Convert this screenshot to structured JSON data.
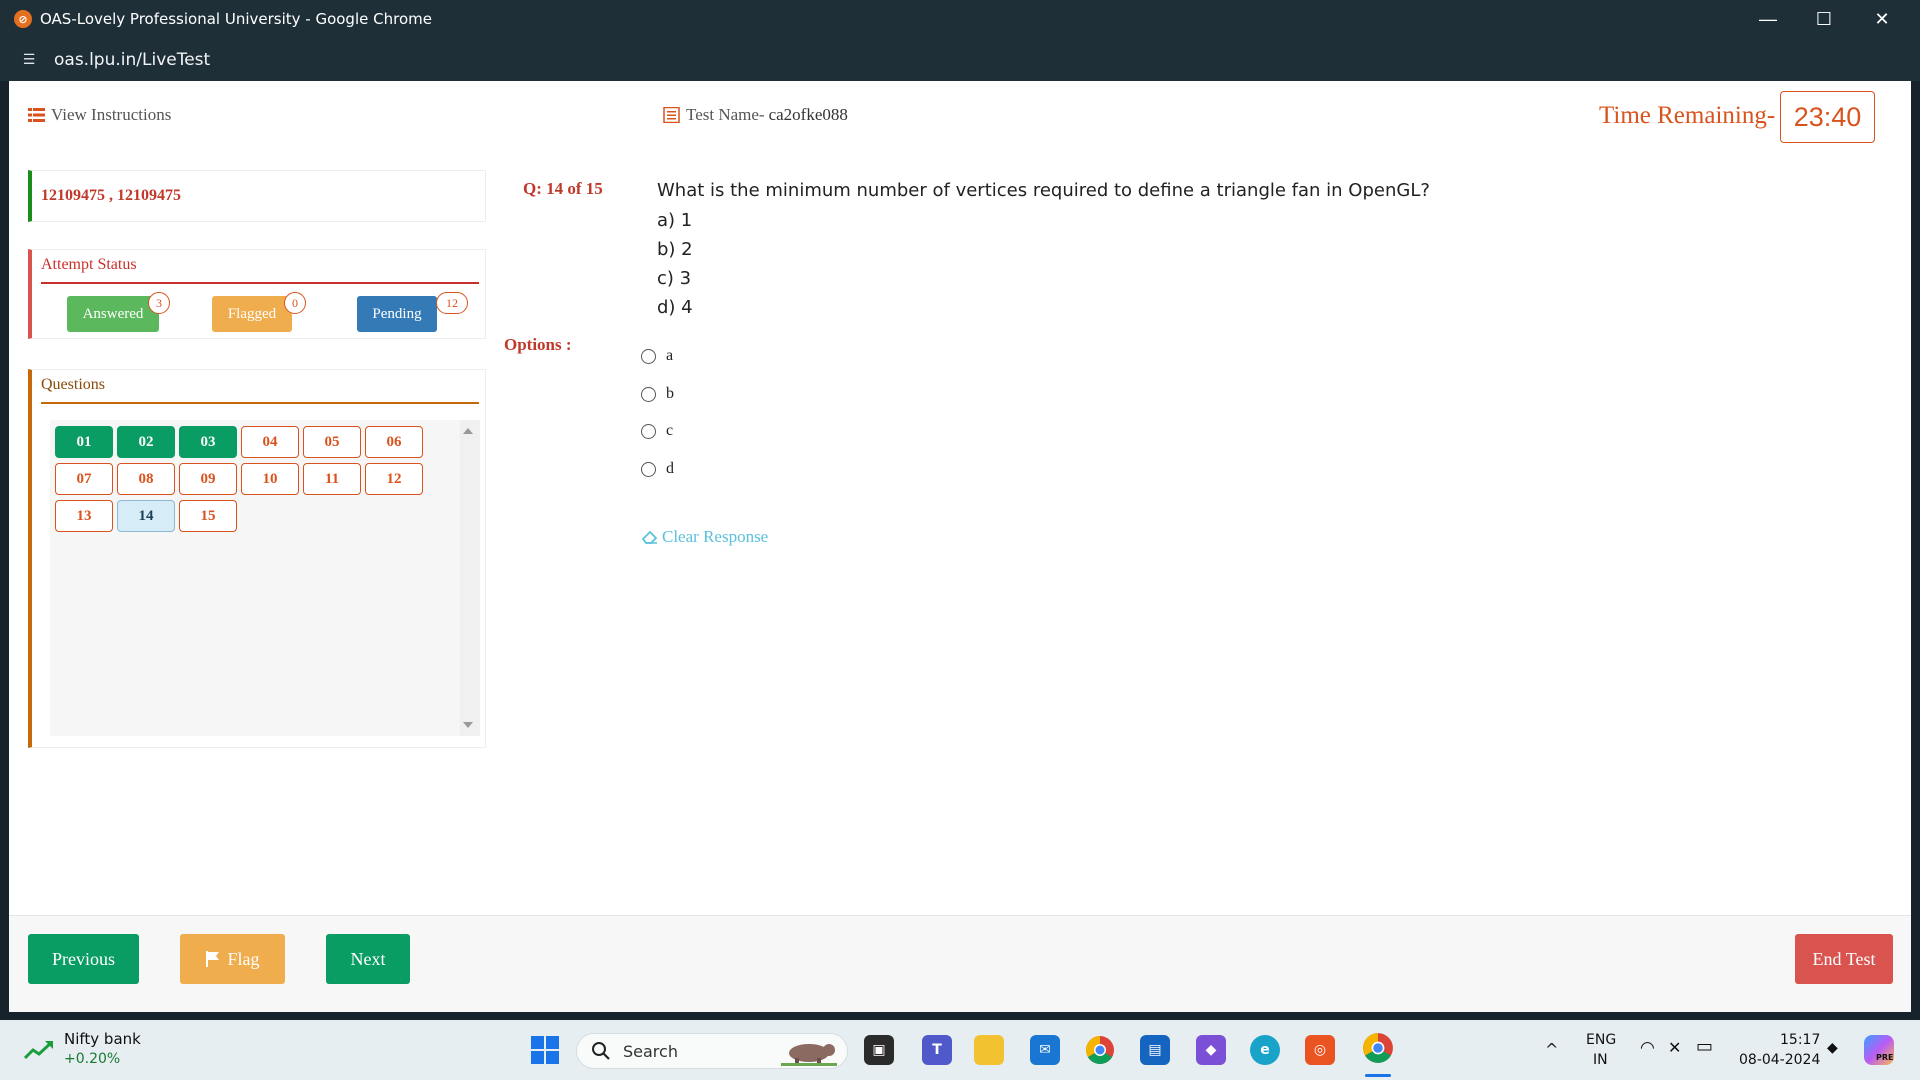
{
  "browser": {
    "window_title": "OAS-Lovely Professional University - Google Chrome",
    "favicon_glyph": "⊘",
    "url": "oas.lpu.in/LiveTest",
    "minimize_glyph": "—",
    "maximize_glyph": "☐",
    "close_glyph": "✕",
    "site_info_glyph": "☰"
  },
  "header": {
    "view_instructions": "View Instructions",
    "test_name_label": "Test Name-",
    "test_name_value": "ca2ofke088",
    "time_label": "Time Remaining-",
    "time_value": "23:40"
  },
  "user": {
    "ids": "12109475 , 12109475"
  },
  "attempt_status": {
    "title": "Attempt Status",
    "answered_label": "Answered",
    "answered_count": "3",
    "flagged_label": "Flagged",
    "flagged_count": "0",
    "pending_label": "Pending",
    "pending_count": "12"
  },
  "questions_panel": {
    "title": "Questions",
    "items": [
      {
        "label": "01",
        "state": "answered"
      },
      {
        "label": "02",
        "state": "answered"
      },
      {
        "label": "03",
        "state": "answered"
      },
      {
        "label": "04",
        "state": "pending"
      },
      {
        "label": "05",
        "state": "pending"
      },
      {
        "label": "06",
        "state": "pending"
      },
      {
        "label": "07",
        "state": "pending"
      },
      {
        "label": "08",
        "state": "pending"
      },
      {
        "label": "09",
        "state": "pending"
      },
      {
        "label": "10",
        "state": "pending"
      },
      {
        "label": "11",
        "state": "pending"
      },
      {
        "label": "12",
        "state": "pending"
      },
      {
        "label": "13",
        "state": "pending"
      },
      {
        "label": "14",
        "state": "current"
      },
      {
        "label": "15",
        "state": "pending"
      }
    ]
  },
  "question": {
    "number_label": "Q: 14 of 15",
    "text": "What is the minimum number of vertices required to define a triangle fan in OpenGL?",
    "choices": [
      "a) 1",
      "b) 2",
      "c) 3",
      "d) 4"
    ]
  },
  "options": {
    "label": "Options :",
    "values": [
      "a",
      "b",
      "c",
      "d"
    ],
    "clear_response": "Clear Response"
  },
  "footer": {
    "previous": "Previous",
    "flag": "Flag",
    "next": "Next",
    "end_test": "End Test"
  },
  "taskbar": {
    "widget_title": "Nifty bank",
    "widget_value": "+0.20%",
    "search_placeholder": "Search",
    "language_line1": "ENG",
    "language_line2": "IN",
    "time": "15:17",
    "date": "08-04-2024",
    "chevron_glyph": "^",
    "wifi_glyph": "◠",
    "volume_glyph": "✕",
    "battery_glyph": "▭",
    "bell_glyph": "◆",
    "copilot_badge": "PRE"
  },
  "colors": {
    "answered": "#0a9d63",
    "flagged": "#f0ad4e",
    "pending_btn": "#337ab7",
    "accent_orange": "#d9531e",
    "end_test": "#d9534f"
  }
}
